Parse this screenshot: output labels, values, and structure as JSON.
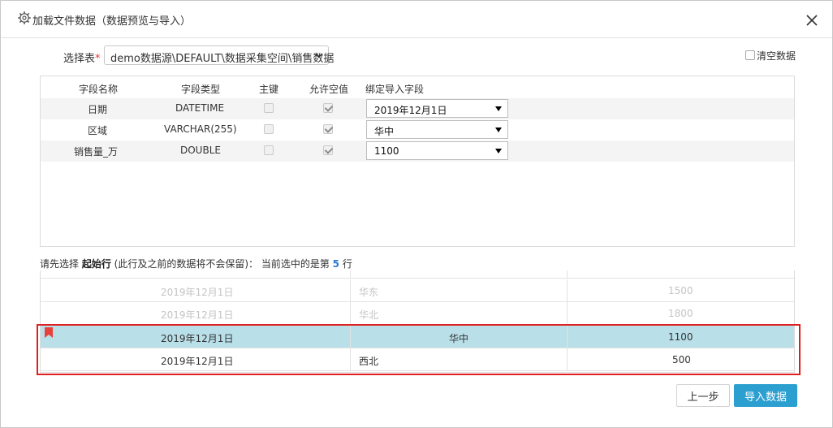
{
  "dialog": {
    "title": "加载文件数据（数据预览与导入）",
    "close_label": "关闭"
  },
  "table_select": {
    "label": "选择表",
    "required_mark": "*",
    "value": "demo数据源\\DEFAULT\\数据采集空间\\销售数据"
  },
  "clear_data": {
    "label": "清空数据",
    "checked": false
  },
  "fields": {
    "headers": {
      "name": "字段名称",
      "type": "字段类型",
      "primary_key": "主键",
      "nullable": "允许空值",
      "bind": "绑定导入字段"
    },
    "rows": [
      {
        "name": "日期",
        "type": "DATETIME",
        "primary_key": false,
        "nullable": true,
        "bind": "2019年12月1日"
      },
      {
        "name": "区域",
        "type": "VARCHAR(255)",
        "primary_key": false,
        "nullable": true,
        "bind": "华中"
      },
      {
        "name": "销售量_万",
        "type": "DOUBLE",
        "primary_key": false,
        "nullable": true,
        "bind": "1100"
      }
    ]
  },
  "hint": {
    "prefix": "请先选择 ",
    "bold": "起始行",
    "middle": " (此行及之前的数据将不会保留)： 当前选中的是第 ",
    "row_number": "5",
    "suffix": " 行"
  },
  "preview": {
    "rows": [
      {
        "date": "2019年12月1日",
        "region": "华东",
        "amount": "1500",
        "state": "dim"
      },
      {
        "date": "2019年12月1日",
        "region": "华北",
        "amount": "1800",
        "state": "dim"
      },
      {
        "date": "2019年12月1日",
        "region": "华中",
        "amount": "1100",
        "state": "selected"
      },
      {
        "date": "2019年12月1日",
        "region": "西北",
        "amount": "500",
        "state": "normal"
      }
    ]
  },
  "buttons": {
    "prev": "上一步",
    "import": "导入数据"
  },
  "colors": {
    "accent": "#2b9fd0",
    "selected_row": "#b9dfe9",
    "highlight_outline": "#e02020",
    "required": "#e4393c",
    "bookmark": "#e8413c"
  }
}
